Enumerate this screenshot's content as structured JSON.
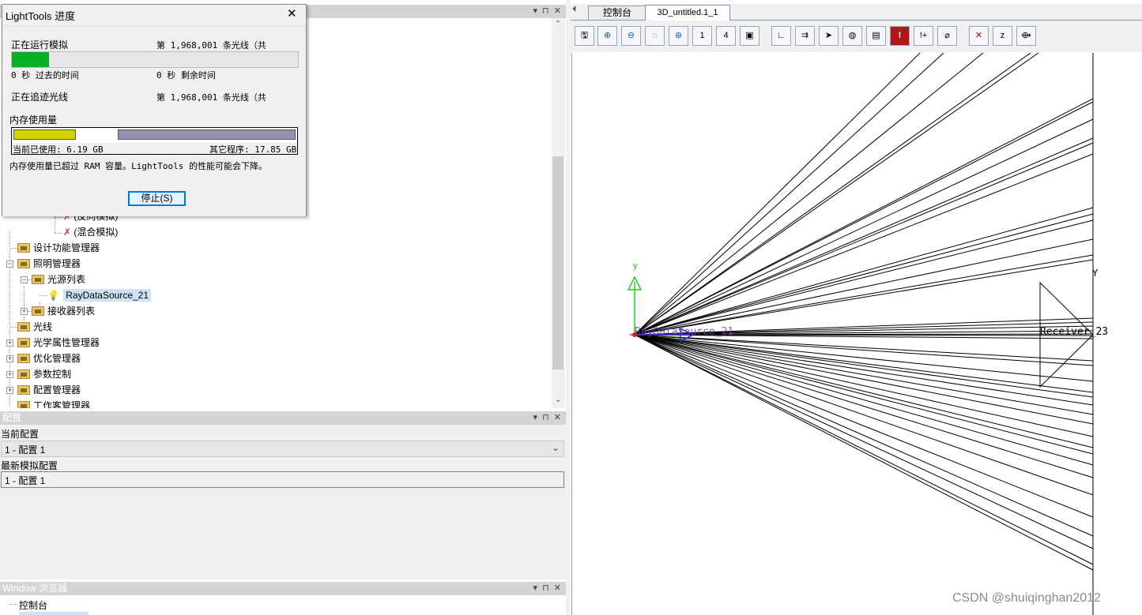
{
  "dialog": {
    "title": "LightTools 进度",
    "close_glyph": "✕",
    "running_label": "正在运行模拟",
    "running_value": "第 1,968,001 条光线（共",
    "progress_fraction": 0.13,
    "elapsed": "0 秒 过去的时间",
    "remaining": "0 秒 剩余时间",
    "tracing_label": "正在追迹光线",
    "tracing_value": "第 1,968,001 条光线（共",
    "memory_label": "内存使用量",
    "mem_used_fraction": 0.22,
    "mem_other_fraction": 0.63,
    "mem_current": "当前已使用: 6.19 GB",
    "mem_other": "其它程序: 17.85 GB",
    "warning": "内存使用量已超过 RAM 容量。LightTools 的性能可能会下降。",
    "stop_button": "停止(S)"
  },
  "tree": {
    "items": [
      {
        "label": "(反向模拟)"
      },
      {
        "label": "(混合模拟)"
      },
      {
        "label": "设计功能管理器"
      },
      {
        "label": "照明管理器"
      },
      {
        "label": "光源列表"
      },
      {
        "label": "RayDataSource_21"
      },
      {
        "label": "接收器列表"
      },
      {
        "label": "光线"
      },
      {
        "label": "光学属性管理器"
      },
      {
        "label": "优化管理器"
      },
      {
        "label": "参数控制"
      },
      {
        "label": "配置管理器"
      },
      {
        "label": "工作客管理器"
      }
    ]
  },
  "config_panel": {
    "title": "配置",
    "current_label": "当前配置",
    "current_value": "1 - 配置 1",
    "latest_label": "最新模拟配置",
    "latest_value": "1 - 配置 1"
  },
  "window_browser": {
    "title": "Window 浏览器",
    "item": "控制台"
  },
  "tabs": {
    "console": "控制台",
    "view": "3D_untitled.1_1"
  },
  "viewport": {
    "source_label": "RayDataSource_21",
    "receiver_label": "Receiver_23",
    "axis_y": "y",
    "axis_y_right": "Y"
  },
  "toolbar": {
    "icons": [
      "save-icon",
      "zoom-in-icon",
      "zoom-out-icon",
      "zoom-window-icon",
      "zoom-all-icon",
      "view-1-icon",
      "view-4-icon",
      "cube-view-icon",
      "axes-icon",
      "ray-trace-icon",
      "select-arrow-icon",
      "lens-icon",
      "properties-icon",
      "stop-icon",
      "warning-icon",
      "filter-icon",
      "no-rays-icon",
      "z-icon",
      "lens-fan-icon"
    ]
  },
  "watermark": "CSDN @shuiqinghan2012"
}
